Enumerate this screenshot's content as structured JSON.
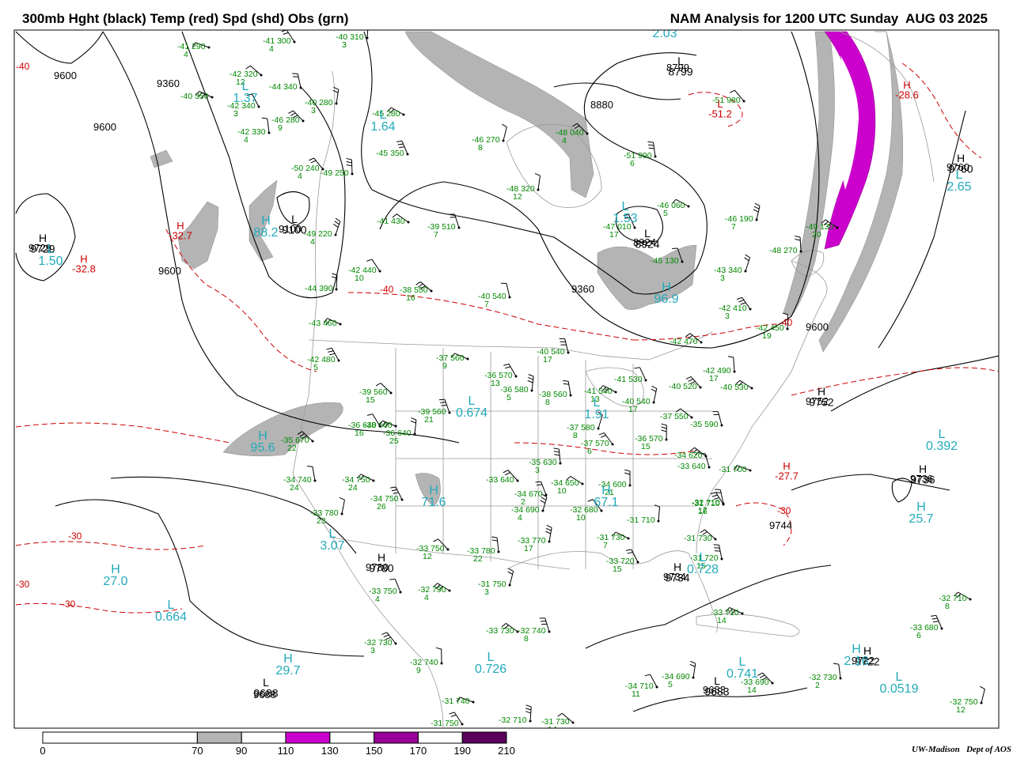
{
  "header": {
    "left_title": "300mb Hght (black) Temp (red) Spd (shd) Obs (grn)",
    "right_title": "NAM Analysis for 1200 UTC Sunday  AUG 03 2025"
  },
  "colors": {
    "height_contour": "#000000",
    "temperature_contour": "#cc0000",
    "observations": "#008800",
    "wind_speed_center_labels": "#22aabb",
    "geography": "#999999",
    "speed_70_90": "#b4b4b4",
    "speed_110_130": "#cc00cc",
    "speed_150_170": "#990099",
    "speed_190_210": "#5a005a"
  },
  "legend": {
    "title": "wind speed shading",
    "ticks": [
      "0",
      "70",
      "90",
      "110",
      "130",
      "150",
      "170",
      "190",
      "210"
    ],
    "bins": [
      {
        "range": "70-90",
        "color": "#b4b4b4"
      },
      {
        "range": "110-130",
        "color": "#cc00cc"
      },
      {
        "range": "150-170",
        "color": "#990099"
      },
      {
        "range": "190-210",
        "color": "#5a005a"
      }
    ]
  },
  "credit": "UW-Madison   Dept of AOS",
  "height_labels": [
    "9600",
    "9360",
    "9600",
    "9100",
    "9600",
    "8799",
    "8880",
    "8924",
    "9360",
    "9600",
    "9780",
    "9734",
    "9688",
    "9683",
    "9744",
    "9736",
    "9722",
    "9760",
    "9752",
    "9729"
  ],
  "temperature_labels": [
    "-30",
    "-30",
    "-40",
    "-40",
    "-30",
    "-30",
    "-40"
  ],
  "height_centers": [
    {
      "mark": "H",
      "value": "9729"
    },
    {
      "mark": "L",
      "value": "9100"
    },
    {
      "mark": "L",
      "value": "8799"
    },
    {
      "mark": "L",
      "value": "8924"
    },
    {
      "mark": "H",
      "value": "9760"
    },
    {
      "mark": "H",
      "value": "9780"
    },
    {
      "mark": "H",
      "value": "9734"
    },
    {
      "mark": "L",
      "value": "9688"
    },
    {
      "mark": "L",
      "value": "9683"
    },
    {
      "mark": "H",
      "value": "9752"
    },
    {
      "mark": "H",
      "value": "9736"
    },
    {
      "mark": "H",
      "value": "9722"
    }
  ],
  "temperature_centers": [
    {
      "mark": "H",
      "value": "-32.7"
    },
    {
      "mark": "H",
      "value": "-32.8"
    },
    {
      "mark": "L",
      "value": "-51.2"
    },
    {
      "mark": "H",
      "value": "-28.6"
    },
    {
      "mark": "H",
      "value": "-27.7"
    }
  ],
  "speed_centers": [
    {
      "mark": "L",
      "value": "1.50"
    },
    {
      "mark": "H",
      "value": "88.2"
    },
    {
      "mark": "L",
      "value": "1.37"
    },
    {
      "mark": "L",
      "value": "1.64"
    },
    {
      "mark": "L",
      "value": "2.03"
    },
    {
      "mark": "L",
      "value": "1.53"
    },
    {
      "mark": "H",
      "value": "96.9"
    },
    {
      "mark": "L",
      "value": "2.65"
    },
    {
      "mark": "L",
      "value": "0.674"
    },
    {
      "mark": "H",
      "value": "95.6"
    },
    {
      "mark": "L",
      "value": "1.91"
    },
    {
      "mark": "H",
      "value": "71.6"
    },
    {
      "mark": "H",
      "value": "67.1"
    },
    {
      "mark": "L",
      "value": "3.07"
    },
    {
      "mark": "H",
      "value": "27.0"
    },
    {
      "mark": "L",
      "value": "0.664"
    },
    {
      "mark": "H",
      "value": "29.7"
    },
    {
      "mark": "L",
      "value": "0.726"
    },
    {
      "mark": "L",
      "value": "0.741"
    },
    {
      "mark": "L",
      "value": "0.728"
    },
    {
      "mark": "L",
      "value": "0.392"
    },
    {
      "mark": "H",
      "value": "25.7"
    },
    {
      "mark": "L",
      "value": "0.0519"
    },
    {
      "mark": "H",
      "value": "2.16"
    }
  ],
  "observations": [
    {
      "temp": "-41",
      "height": "290",
      "dewpoint_depression": "4"
    },
    {
      "temp": "-41",
      "height": "300",
      "dewpoint_depression": "4"
    },
    {
      "temp": "-40",
      "height": "310",
      "dewpoint_depression": "3"
    },
    {
      "temp": "-42",
      "height": "320",
      "dewpoint_depression": "12"
    },
    {
      "temp": "-44",
      "height": "340",
      "dewpoint_depression": ""
    },
    {
      "temp": "-40",
      "height": "350",
      "dewpoint_depression": ""
    },
    {
      "temp": "-42",
      "height": "340",
      "dewpoint_depression": "3"
    },
    {
      "temp": "-40",
      "height": "280",
      "dewpoint_depression": "3"
    },
    {
      "temp": "-46",
      "height": "280",
      "dewpoint_depression": "9"
    },
    {
      "temp": "-42",
      "height": "330",
      "dewpoint_depression": "4"
    },
    {
      "temp": "-45",
      "height": "280",
      "dewpoint_depression": ""
    },
    {
      "temp": "-45",
      "height": "350",
      "dewpoint_depression": ""
    },
    {
      "temp": "-46",
      "height": "270",
      "dewpoint_depression": "8"
    },
    {
      "temp": "-50",
      "height": "240",
      "dewpoint_depression": "4"
    },
    {
      "temp": "-49",
      "height": "250",
      "dewpoint_depression": ""
    },
    {
      "temp": "-41",
      "height": "430",
      "dewpoint_depression": ""
    },
    {
      "temp": "-39",
      "height": "510",
      "dewpoint_depression": "7"
    },
    {
      "temp": "-49",
      "height": "220",
      "dewpoint_depression": "4"
    },
    {
      "temp": "-42",
      "height": "440",
      "dewpoint_depression": "10"
    },
    {
      "temp": "-44",
      "height": "390",
      "dewpoint_depression": ""
    },
    {
      "temp": "-38",
      "height": "550",
      "dewpoint_depression": "16"
    },
    {
      "temp": "-40",
      "height": "540",
      "dewpoint_depression": "7"
    },
    {
      "temp": "-43",
      "height": "460",
      "dewpoint_depression": ""
    },
    {
      "temp": "-42",
      "height": "480",
      "dewpoint_depression": "5"
    },
    {
      "temp": "-48",
      "height": "320",
      "dewpoint_depression": "12"
    },
    {
      "temp": "-48",
      "height": "040",
      "dewpoint_depression": "4"
    },
    {
      "temp": "-51",
      "height": "990",
      "dewpoint_depression": "6"
    },
    {
      "temp": "-46",
      "height": "060",
      "dewpoint_depression": "5"
    },
    {
      "temp": "-47",
      "height": "010",
      "dewpoint_depression": "17"
    },
    {
      "temp": "-46",
      "height": "190",
      "dewpoint_depression": "7"
    },
    {
      "temp": "-51",
      "height": "980",
      "dewpoint_depression": ""
    },
    {
      "temp": "-48",
      "height": "270",
      "dewpoint_depression": ""
    },
    {
      "temp": "-49",
      "height": "130",
      "dewpoint_depression": "20"
    },
    {
      "temp": "-45",
      "height": "130",
      "dewpoint_depression": ""
    },
    {
      "temp": "-43",
      "height": "340",
      "dewpoint_depression": "3"
    },
    {
      "temp": "-42",
      "height": "410",
      "dewpoint_depression": "3"
    },
    {
      "temp": "-42",
      "height": "450",
      "dewpoint_depression": "19"
    },
    {
      "temp": "-42",
      "height": "470",
      "dewpoint_depression": ""
    },
    {
      "temp": "-40",
      "height": "540",
      "dewpoint_depression": "17"
    },
    {
      "temp": "-37",
      "height": "560",
      "dewpoint_depression": "9"
    },
    {
      "temp": "-36",
      "height": "570",
      "dewpoint_depression": "13"
    },
    {
      "temp": "-36",
      "height": "580",
      "dewpoint_depression": "5"
    },
    {
      "temp": "-39",
      "height": "560",
      "dewpoint_depression": "15"
    },
    {
      "temp": "-38",
      "height": "560",
      "dewpoint_depression": "8"
    },
    {
      "temp": "-41",
      "height": "540",
      "dewpoint_depression": "13"
    },
    {
      "temp": "-41",
      "height": "530",
      "dewpoint_depression": ""
    },
    {
      "temp": "-40",
      "height": "540",
      "dewpoint_depression": "17"
    },
    {
      "temp": "-40",
      "height": "520",
      "dewpoint_depression": ""
    },
    {
      "temp": "-42",
      "height": "490",
      "dewpoint_depression": "17"
    },
    {
      "temp": "-40",
      "height": "530",
      "dewpoint_depression": ""
    },
    {
      "temp": "-39",
      "height": "560",
      "dewpoint_depression": "21"
    },
    {
      "temp": "-37",
      "height": "580",
      "dewpoint_depression": "8"
    },
    {
      "temp": "-37",
      "height": "570",
      "dewpoint_depression": "6"
    },
    {
      "temp": "-36",
      "height": "570",
      "dewpoint_depression": "15"
    },
    {
      "temp": "-37",
      "height": "550",
      "dewpoint_depression": ""
    },
    {
      "temp": "-35",
      "height": "590",
      "dewpoint_depression": ""
    },
    {
      "temp": "-38",
      "height": "640",
      "dewpoint_depression": ""
    },
    {
      "temp": "-36",
      "height": "640",
      "dewpoint_depression": "16"
    },
    {
      "temp": "-36",
      "height": "640",
      "dewpoint_depression": "25"
    },
    {
      "temp": "-35",
      "height": "670",
      "dewpoint_depression": "22"
    },
    {
      "temp": "-34",
      "height": "740",
      "dewpoint_depression": "24"
    },
    {
      "temp": "-34",
      "height": "750",
      "dewpoint_depression": "24"
    },
    {
      "temp": "-34",
      "height": "750",
      "dewpoint_depression": "26"
    },
    {
      "temp": "-33",
      "height": "780",
      "dewpoint_depression": "23"
    },
    {
      "temp": "-33",
      "height": "640",
      "dewpoint_depression": ""
    },
    {
      "temp": "-35",
      "height": "630",
      "dewpoint_depression": "3"
    },
    {
      "temp": "-34",
      "height": "650",
      "dewpoint_depression": "10"
    },
    {
      "temp": "-34",
      "height": "670",
      "dewpoint_depression": "2"
    },
    {
      "temp": "-34",
      "height": "690",
      "dewpoint_depression": "4"
    },
    {
      "temp": "-32",
      "height": "680",
      "dewpoint_depression": "10"
    },
    {
      "temp": "-34",
      "height": "600",
      "dewpoint_depression": "21"
    },
    {
      "temp": "-34",
      "height": "620",
      "dewpoint_depression": ""
    },
    {
      "temp": "-33",
      "height": "640",
      "dewpoint_depression": ""
    },
    {
      "temp": "-31",
      "height": "700",
      "dewpoint_depression": ""
    },
    {
      "temp": "-31",
      "height": "710",
      "dewpoint_depression": "16"
    },
    {
      "temp": "-31",
      "height": "710",
      "dewpoint_depression": ""
    },
    {
      "temp": "-31",
      "height": "730",
      "dewpoint_depression": ""
    },
    {
      "temp": "-31",
      "height": "720",
      "dewpoint_depression": "15"
    },
    {
      "temp": "-31",
      "height": "730",
      "dewpoint_depression": "7"
    },
    {
      "temp": "-33",
      "height": "720",
      "dewpoint_depression": "15"
    },
    {
      "temp": "-33",
      "height": "770",
      "dewpoint_depression": "17"
    },
    {
      "temp": "-33",
      "height": "750",
      "dewpoint_depression": "12"
    },
    {
      "temp": "-33",
      "height": "780",
      "dewpoint_depression": "22"
    },
    {
      "temp": "-32",
      "height": "790",
      "dewpoint_depression": "4"
    },
    {
      "temp": "-33",
      "height": "750",
      "dewpoint_depression": "4"
    },
    {
      "temp": "-31",
      "height": "750",
      "dewpoint_depression": "3"
    },
    {
      "temp": "-32",
      "height": "730",
      "dewpoint_depression": "3"
    },
    {
      "temp": "-32",
      "height": "740",
      "dewpoint_depression": "9"
    },
    {
      "temp": "-33",
      "height": "730",
      "dewpoint_depression": ""
    },
    {
      "temp": "-32",
      "height": "740",
      "dewpoint_depression": "8"
    },
    {
      "temp": "-31",
      "height": "740",
      "dewpoint_depression": ""
    },
    {
      "temp": "-31",
      "height": "750",
      "dewpoint_depression": ""
    },
    {
      "temp": "-32",
      "height": "710",
      "dewpoint_depression": ""
    },
    {
      "temp": "-31",
      "height": "730",
      "dewpoint_depression": "14"
    },
    {
      "temp": "-32",
      "height": "710",
      "dewpoint_depression": "17"
    },
    {
      "temp": "-33",
      "height": "710",
      "dewpoint_depression": "14"
    },
    {
      "temp": "-34",
      "height": "710",
      "dewpoint_depression": "11"
    },
    {
      "temp": "-34",
      "height": "690",
      "dewpoint_depression": "5"
    },
    {
      "temp": "-33",
      "height": "690",
      "dewpoint_depression": "14"
    },
    {
      "temp": "-32",
      "height": "730",
      "dewpoint_depression": "2"
    },
    {
      "temp": "-32",
      "height": "710",
      "dewpoint_depression": "8"
    },
    {
      "temp": "-33",
      "height": "680",
      "dewpoint_depression": "6"
    },
    {
      "temp": "-32",
      "height": "750",
      "dewpoint_depression": "12"
    }
  ]
}
